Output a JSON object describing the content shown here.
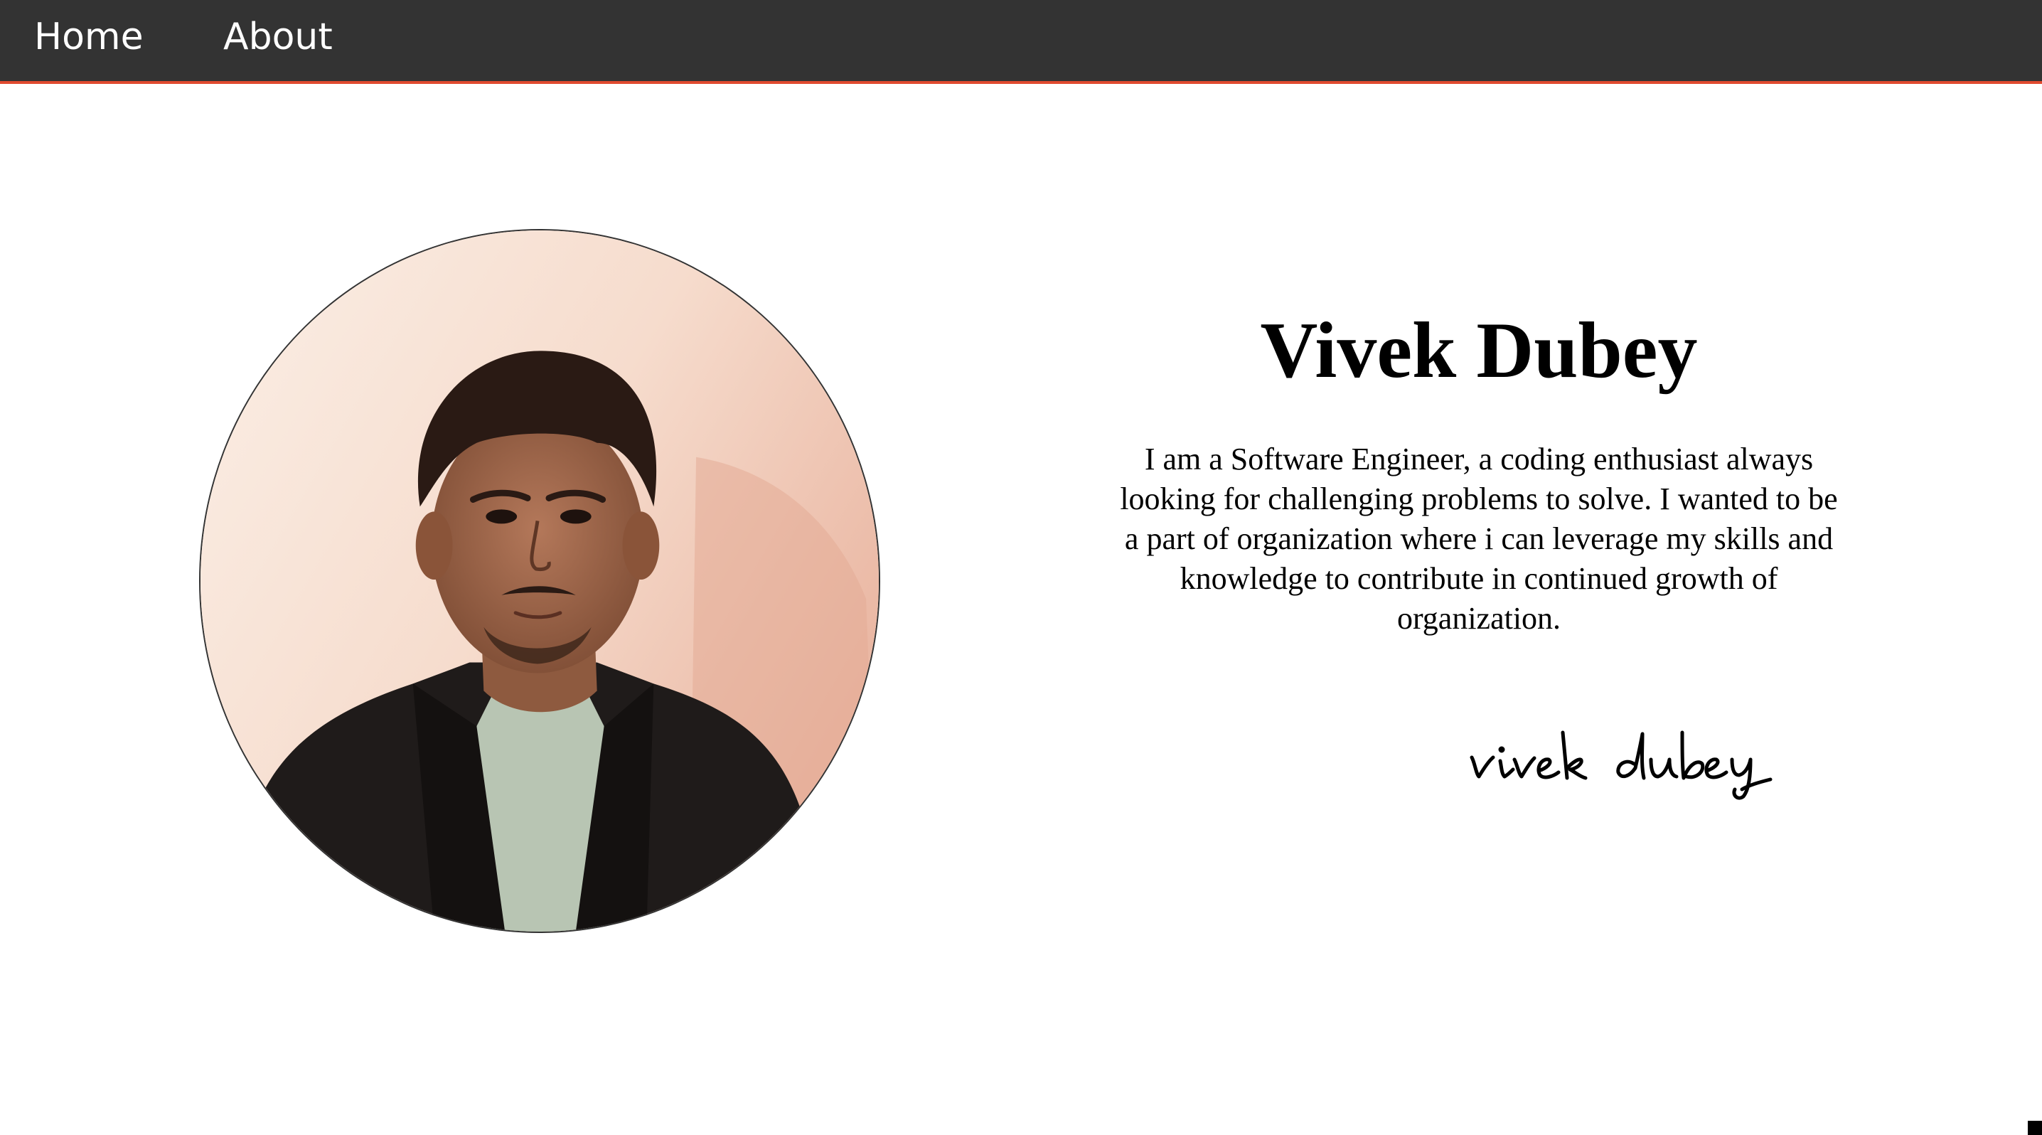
{
  "nav": {
    "home_label": "Home",
    "about_label": "About"
  },
  "profile": {
    "name": "Vivek Dubey",
    "bio": "I am a Software Engineer, a coding enthusiast always looking for challenging problems to solve. I wanted to be a part of organization where i can leverage my skills and knowledge to contribute in continued growth of organization.",
    "signature_text": "vivek dubey",
    "photo_icon": "profile-photo"
  },
  "colors": {
    "navbar_bg": "#333333",
    "navbar_accent": "#e04a2f",
    "text": "#000000",
    "background": "#ffffff"
  }
}
